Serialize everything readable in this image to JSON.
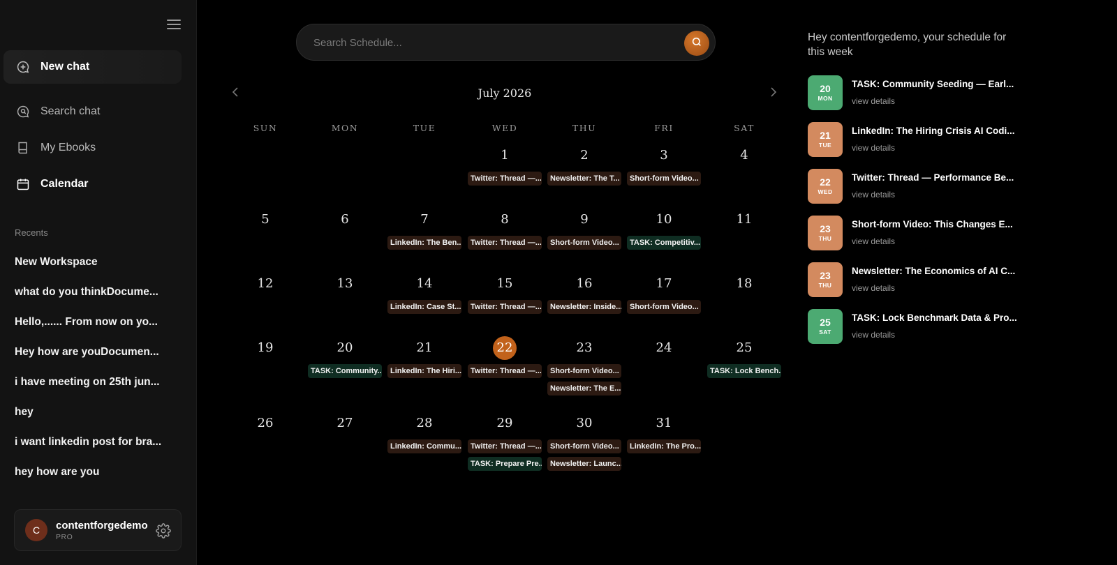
{
  "sidebar": {
    "nav": {
      "new_chat": "New chat",
      "search_chat": "Search chat",
      "my_ebooks": "My Ebooks",
      "calendar": "Calendar"
    },
    "recents_title": "Recents",
    "recents": [
      "New Workspace",
      "what do you thinkDocume...",
      "Hello,...... From now on yo...",
      "Hey how are youDocumen...",
      "i have meeting on 25th jun...",
      "hey",
      "i want linkedin post for bra...",
      "hey how are you"
    ],
    "user": {
      "initial": "C",
      "name": "contentforgedemo",
      "plan": "PRO"
    }
  },
  "search": {
    "placeholder": "Search Schedule..."
  },
  "calendar": {
    "title": "July 2026",
    "weekdays": [
      "SUN",
      "MON",
      "TUE",
      "WED",
      "THU",
      "FRI",
      "SAT"
    ],
    "today": 22,
    "weeks": [
      [
        null,
        null,
        null,
        {
          "d": 1,
          "ev": [
            {
              "t": "Twitter: Thread —...",
              "k": "content"
            }
          ]
        },
        {
          "d": 2,
          "ev": [
            {
              "t": "Newsletter: The T...",
              "k": "content"
            }
          ]
        },
        {
          "d": 3,
          "ev": [
            {
              "t": "Short-form Video...",
              "k": "content"
            }
          ]
        },
        {
          "d": 4,
          "ev": []
        }
      ],
      [
        {
          "d": 5,
          "ev": []
        },
        {
          "d": 6,
          "ev": []
        },
        {
          "d": 7,
          "ev": [
            {
              "t": "LinkedIn: The Ben...",
              "k": "content"
            }
          ]
        },
        {
          "d": 8,
          "ev": [
            {
              "t": "Twitter: Thread —...",
              "k": "content"
            }
          ]
        },
        {
          "d": 9,
          "ev": [
            {
              "t": "Short-form Video...",
              "k": "content"
            }
          ]
        },
        {
          "d": 10,
          "ev": [
            {
              "t": "TASK: Competitiv...",
              "k": "task"
            }
          ]
        },
        {
          "d": 11,
          "ev": []
        }
      ],
      [
        {
          "d": 12,
          "ev": []
        },
        {
          "d": 13,
          "ev": []
        },
        {
          "d": 14,
          "ev": [
            {
              "t": "LinkedIn: Case St...",
              "k": "content"
            }
          ]
        },
        {
          "d": 15,
          "ev": [
            {
              "t": "Twitter: Thread —...",
              "k": "content"
            }
          ]
        },
        {
          "d": 16,
          "ev": [
            {
              "t": "Newsletter: Inside...",
              "k": "content"
            }
          ]
        },
        {
          "d": 17,
          "ev": [
            {
              "t": "Short-form Video...",
              "k": "content"
            }
          ]
        },
        {
          "d": 18,
          "ev": []
        }
      ],
      [
        {
          "d": 19,
          "ev": []
        },
        {
          "d": 20,
          "ev": [
            {
              "t": "TASK: Community...",
              "k": "task"
            }
          ]
        },
        {
          "d": 21,
          "ev": [
            {
              "t": "LinkedIn: The Hiri...",
              "k": "content"
            }
          ]
        },
        {
          "d": 22,
          "ev": [
            {
              "t": "Twitter: Thread —...",
              "k": "content"
            }
          ]
        },
        {
          "d": 23,
          "ev": [
            {
              "t": "Short-form Video...",
              "k": "content"
            },
            {
              "t": "Newsletter: The E...",
              "k": "content"
            }
          ]
        },
        {
          "d": 24,
          "ev": []
        },
        {
          "d": 25,
          "ev": [
            {
              "t": "TASK: Lock Bench...",
              "k": "task"
            }
          ]
        }
      ],
      [
        {
          "d": 26,
          "ev": []
        },
        {
          "d": 27,
          "ev": []
        },
        {
          "d": 28,
          "ev": [
            {
              "t": "LinkedIn: Commu...",
              "k": "content"
            }
          ]
        },
        {
          "d": 29,
          "ev": [
            {
              "t": "Twitter: Thread —...",
              "k": "content"
            },
            {
              "t": "TASK: Prepare Pre...",
              "k": "task"
            }
          ]
        },
        {
          "d": 30,
          "ev": [
            {
              "t": "Short-form Video...",
              "k": "content"
            },
            {
              "t": "Newsletter: Launc...",
              "k": "content"
            }
          ]
        },
        {
          "d": 31,
          "ev": [
            {
              "t": "LinkedIn: The Pro...",
              "k": "content"
            }
          ]
        },
        null
      ]
    ]
  },
  "schedule": {
    "heading": "Hey contentforgedemo, your schedule for this week",
    "link_label": "view details",
    "items": [
      {
        "num": "20",
        "day": "MON",
        "title": "TASK: Community Seeding — Earl...",
        "color": "#4caa72"
      },
      {
        "num": "21",
        "day": "TUE",
        "title": "LinkedIn: The Hiring Crisis AI Codi...",
        "color": "#d38a5f"
      },
      {
        "num": "22",
        "day": "WED",
        "title": "Twitter: Thread — Performance Be...",
        "color": "#d38a5f"
      },
      {
        "num": "23",
        "day": "THU",
        "title": "Short-form Video: This Changes E...",
        "color": "#d38a5f"
      },
      {
        "num": "23",
        "day": "THU",
        "title": "Newsletter: The Economics of AI C...",
        "color": "#d38a5f"
      },
      {
        "num": "25",
        "day": "SAT",
        "title": "TASK: Lock Benchmark Data & Pro...",
        "color": "#4caa72"
      }
    ]
  }
}
